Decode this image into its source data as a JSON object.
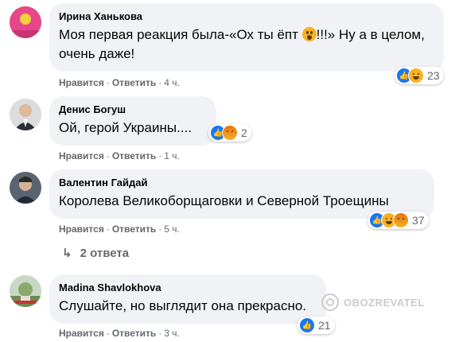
{
  "colors": {
    "bubble_bg": "#f0f2f5",
    "meta_text": "#65676b",
    "like_blue": "#1877f2",
    "haha_yellow": "#f7b125"
  },
  "comments": [
    {
      "author": "Ирина Ханькова",
      "text_before_emoji": "Моя первая реакция была-«Ох ты ёпт ",
      "text_after_emoji": "!!!» Ну а в целом, очень даже!",
      "inline_emoji": "astonished-face",
      "like_label": "Нравится",
      "reply_label": "Ответить",
      "time": "4 ч.",
      "reactions": [
        "like",
        "haha"
      ],
      "reaction_count": "23"
    },
    {
      "author": "Денис Богуш",
      "text": "Ой, герой Украины....",
      "like_label": "Нравится",
      "reply_label": "Ответить",
      "time": "1 ч.",
      "reactions": [
        "like",
        "angry"
      ],
      "reaction_count": "2"
    },
    {
      "author": "Валентин Гайдай",
      "text": "Королева Великоборщаговки и Северной Троещины",
      "like_label": "Нравится",
      "reply_label": "Ответить",
      "time": "5 ч.",
      "reactions": [
        "like",
        "haha",
        "angry"
      ],
      "reaction_count": "37",
      "replies_label": "2 ответа"
    },
    {
      "author": "Madina Shavlokhova",
      "text": "Слушайте, но выглядит она прекрасно.",
      "like_label": "Нравится",
      "reply_label": "Ответить",
      "time": "3 ч.",
      "reactions": [
        "like"
      ],
      "reaction_count": "21"
    }
  ],
  "separator": "·",
  "watermark": "OBOZREVATEL"
}
